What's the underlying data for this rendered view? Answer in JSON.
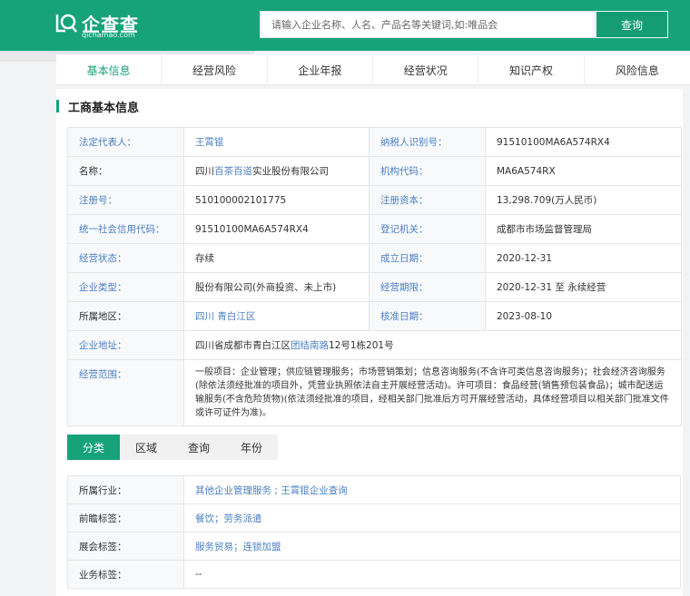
{
  "header": {
    "logo_text": "企查查",
    "logo_domain": "qichamao.com",
    "search_placeholder": "请输入企业名称、人名、产品名等关键词,如:唯品会",
    "search_button": "查询"
  },
  "nav": {
    "items": [
      "基本信息",
      "经营风险",
      "企业年报",
      "经营状况",
      "知识产权",
      "风险信息"
    ],
    "active_index": 0
  },
  "section": {
    "title": "工商基本信息"
  },
  "info": {
    "legal_rep_label": "法定代表人：",
    "legal_rep_value": "王霄锟",
    "taxpayer_id_label": "纳税人识别号：",
    "taxpayer_id_value": "91510100MA6A574RX4",
    "name_label": "名称：",
    "name_prefix": "四川",
    "name_link": "百茶百道",
    "name_suffix": "实业股份有限公司",
    "org_code_label": "机构代码：",
    "org_code_value": "MA6A574RX",
    "reg_no_label": "注册号：",
    "reg_no_value": "510100002101775",
    "reg_capital_label": "注册资本：",
    "reg_capital_value": "13,298.709(万人民币)",
    "credit_code_label": "统一社会信用代码：",
    "credit_code_value": "91510100MA6A574RX4",
    "authority_label": "登记机关：",
    "authority_value": "成都市市场监督管理局",
    "status_label": "经营状态：",
    "status_value": "存续",
    "established_label": "成立日期：",
    "established_value": "2020-12-31",
    "type_label": "企业类型：",
    "type_value": "股份有限公司(外商投资、未上市)",
    "term_label": "经营期限：",
    "term_value": "2020-12-31 至 永续经营",
    "region_label": "所属地区：",
    "region_value_1": "四川",
    "region_value_2": "青白江区",
    "approval_label": "核准日期：",
    "approval_value": "2023-08-10",
    "address_label": "企业地址：",
    "address_prefix": "四川省成都市青白江区",
    "address_link": "团结南路",
    "address_suffix": "12号1栋201号",
    "scope_label": "经营范围：",
    "scope_value": "一般项目：企业管理；供应链管理服务；市场营销策划；信息咨询服务(不含许可类信息咨询服务)；社会经济咨询服务(除依法须经批准的项目外，凭营业执照依法自主开展经营活动)。许可项目：食品经营(销售预包装食品)；城市配送运输服务(不含危险货物)(依法须经批准的项目，经相关部门批准后方可开展经营活动，具体经营项目以相关部门批准文件或许可证件为准)。"
  },
  "tabs": {
    "items": [
      "分类",
      "区域",
      "查询",
      "年份"
    ],
    "active_index": 0
  },
  "classification": {
    "industry_label": "所属行业：",
    "industry_value": "其他企业管理服务 ; 王霄锟企业查询",
    "frontier_label": "前瞻标签：",
    "frontier_value": "餐饮；劳务派遣",
    "expo_label": "展会标签：",
    "expo_value": "服务贸易；连锁加盟",
    "business_label": "业务标签：",
    "business_value": "--"
  },
  "colors": {
    "brand": "#17a37a",
    "link": "#4a7fc1"
  }
}
